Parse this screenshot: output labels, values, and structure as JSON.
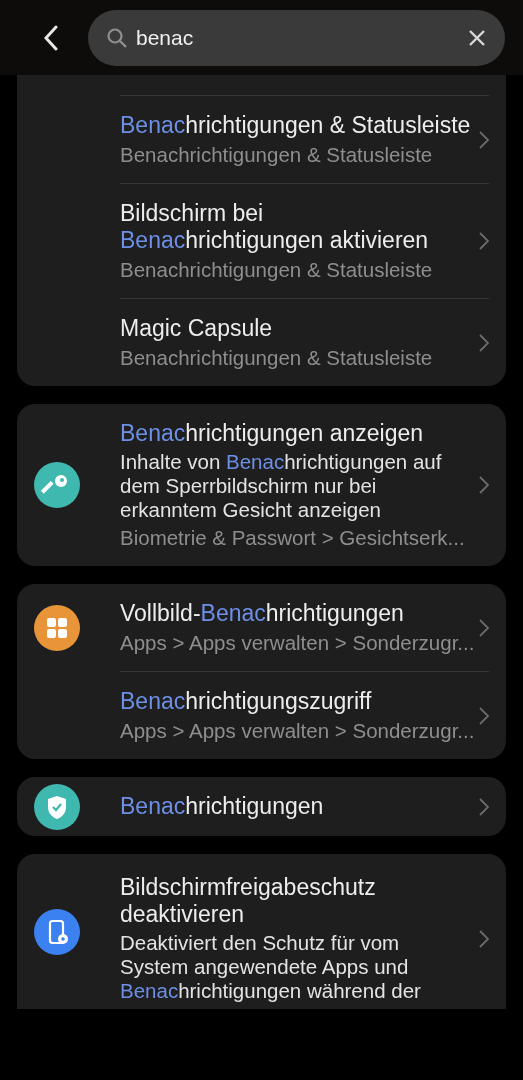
{
  "header": {
    "search": {
      "value": "benac"
    }
  },
  "groups": [
    {
      "continued": true,
      "rows": [
        {
          "title": [
            {
              "text": "Benac",
              "match": true
            },
            {
              "text": "hrichtigungen & Statusleiste",
              "match": false
            }
          ],
          "path": "Benachrichtigungen & Statusleiste"
        },
        {
          "title": [
            {
              "text": "Bildschirm bei ",
              "match": false
            },
            {
              "text": "Benac",
              "match": true
            },
            {
              "text": "hrichtigungen aktivieren",
              "match": false
            }
          ],
          "path": "Benachrichtigungen & Statusleiste"
        },
        {
          "title": [
            {
              "text": "Magic Capsule",
              "match": false
            }
          ],
          "path": "Benachrichtigungen & Statusleiste"
        }
      ]
    },
    {
      "continued": false,
      "rows": [
        {
          "icon": {
            "kind": "key",
            "color": "#3fb8b0"
          },
          "title": [
            {
              "text": "Benac",
              "match": true
            },
            {
              "text": "hrichtigungen anzeigen",
              "match": false
            }
          ],
          "description": [
            {
              "text": "Inhalte von ",
              "match": false
            },
            {
              "text": "Benac",
              "match": true
            },
            {
              "text": "hrichtigungen auf dem Sperrbildschirm nur bei erkanntem Gesicht anzeigen",
              "match": false
            }
          ],
          "path": "Biometrie & Passwort > Gesichtserk..."
        }
      ]
    },
    {
      "continued": false,
      "rows": [
        {
          "icon": {
            "kind": "apps",
            "color": "#e8953a"
          },
          "title": [
            {
              "text": "Vollbild-",
              "match": false
            },
            {
              "text": "Benac",
              "match": true
            },
            {
              "text": "hrichtigungen",
              "match": false
            }
          ],
          "path": "Apps > Apps verwalten > Sonderzugr..."
        },
        {
          "title": [
            {
              "text": "Benac",
              "match": true
            },
            {
              "text": "hrichtigungszugriff",
              "match": false
            }
          ],
          "path": "Apps > Apps verwalten > Sonderzugr..."
        }
      ]
    },
    {
      "continued": false,
      "rows": [
        {
          "icon": {
            "kind": "shield",
            "color": "#3fb8b0"
          },
          "title": [
            {
              "text": "Benac",
              "match": true
            },
            {
              "text": "hrichtigungen",
              "match": false
            }
          ]
        }
      ]
    },
    {
      "continued": false,
      "cut": true,
      "rows": [
        {
          "icon": {
            "kind": "phone-settings",
            "color": "#3b82f0"
          },
          "title": [
            {
              "text": "Bildschirmfreigabeschutz deaktivieren",
              "match": false
            }
          ],
          "description": [
            {
              "text": "Deaktiviert den Schutz für vom System angewendete Apps und ",
              "match": false
            },
            {
              "text": "Benac",
              "match": true
            },
            {
              "text": "hrichtigungen während der",
              "match": false
            }
          ]
        }
      ]
    }
  ]
}
